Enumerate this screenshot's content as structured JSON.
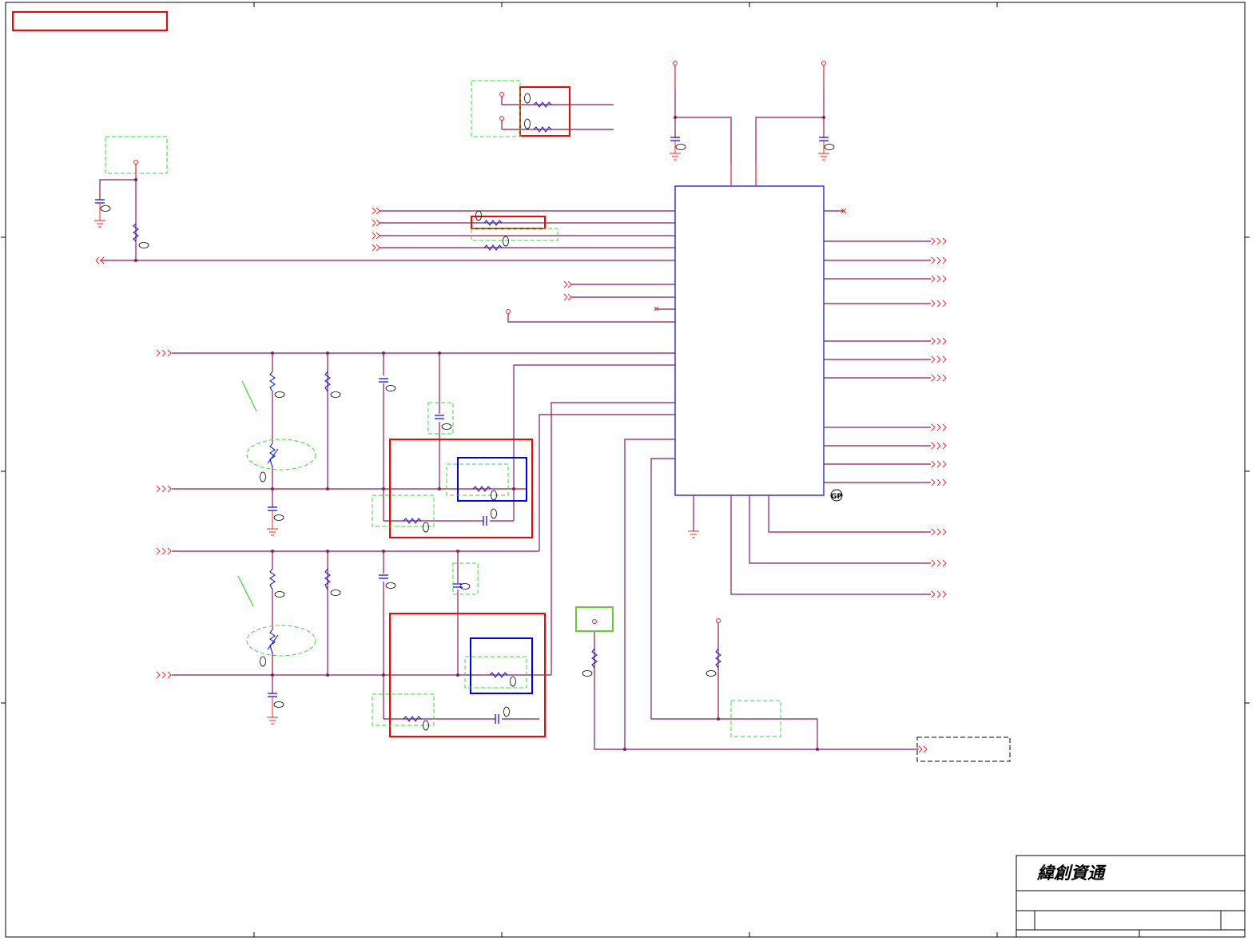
{
  "title_block": {
    "company_name": "緯創資通"
  },
  "markers": {
    "component_tag": "GP"
  },
  "colors": {
    "wire": "#8b1a5b",
    "border": "#000000",
    "component": "#0000ee",
    "port_marker": "#ff2020",
    "highlight_box": "#ff0000",
    "dashed_box": "#33dd33",
    "callout_box": "#66cc33"
  }
}
